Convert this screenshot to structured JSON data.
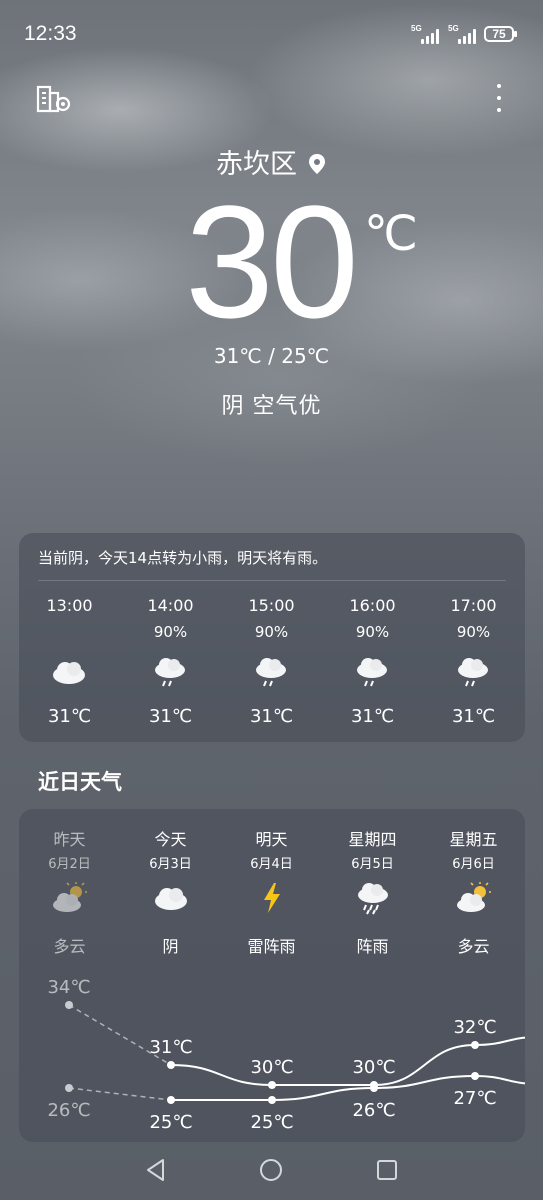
{
  "status": {
    "time": "12:33",
    "sig1": "5G",
    "sig2": "5G",
    "battery": "75"
  },
  "location": {
    "city": "赤坎区"
  },
  "current": {
    "temp": "30",
    "unit": "℃",
    "range": "31℃ / 25℃",
    "condition": "阴  空气优"
  },
  "hourly": {
    "summary": "当前阴，今天14点转为小雨，明天将有雨。",
    "items": [
      {
        "time": "13:00",
        "precip": "",
        "icon": "cloud-icon",
        "temp": "31℃"
      },
      {
        "time": "14:00",
        "precip": "90%",
        "icon": "rain-icon",
        "temp": "31℃"
      },
      {
        "time": "15:00",
        "precip": "90%",
        "icon": "rain-icon",
        "temp": "31℃"
      },
      {
        "time": "16:00",
        "precip": "90%",
        "icon": "rain-icon",
        "temp": "31℃"
      },
      {
        "time": "17:00",
        "precip": "90%",
        "icon": "rain-icon",
        "temp": "31℃"
      }
    ]
  },
  "daily": {
    "title": "近日天气",
    "items": [
      {
        "day": "昨天",
        "date": "6月2日",
        "icon": "partly-cloudy-icon",
        "weather": "多云",
        "high": "34℃",
        "low": "26℃"
      },
      {
        "day": "今天",
        "date": "6月3日",
        "icon": "cloud-icon",
        "weather": "阴",
        "high": "31℃",
        "low": "25℃"
      },
      {
        "day": "明天",
        "date": "6月4日",
        "icon": "lightning-icon",
        "weather": "雷阵雨",
        "high": "30℃",
        "low": "25℃"
      },
      {
        "day": "星期四",
        "date": "6月5日",
        "icon": "shower-icon",
        "weather": "阵雨",
        "high": "30℃",
        "low": "26℃"
      },
      {
        "day": "星期五",
        "date": "6月6日",
        "icon": "partly-cloudy-icon",
        "weather": "多云",
        "high": "32℃",
        "low": "27℃"
      }
    ]
  },
  "colors": {
    "lightning": "#f5c518",
    "sun": "#f3c03a"
  }
}
